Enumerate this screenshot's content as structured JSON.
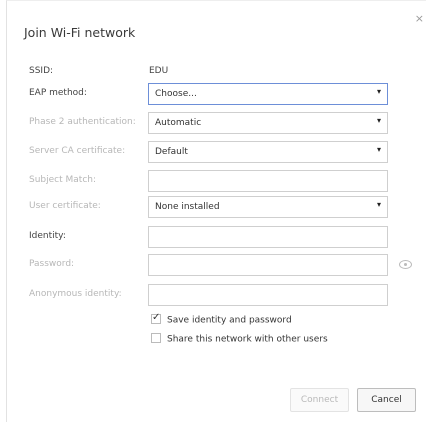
{
  "dialog": {
    "title": "Join Wi-Fi network",
    "close_glyph": "×"
  },
  "form": {
    "ssid": {
      "label": "SSID:",
      "value": "EDU"
    },
    "eap_method": {
      "label": "EAP method:",
      "value": "Choose..."
    },
    "phase2": {
      "label": "Phase 2 authentication:",
      "value": "Automatic"
    },
    "server_ca": {
      "label": "Server CA certificate:",
      "value": "Default"
    },
    "subject_match": {
      "label": "Subject Match:",
      "value": ""
    },
    "user_cert": {
      "label": "User certificate:",
      "value": "None installed"
    },
    "identity": {
      "label": "Identity:",
      "value": ""
    },
    "password": {
      "label": "Password:",
      "value": ""
    },
    "anonymous_identity": {
      "label": "Anonymous identity:",
      "value": ""
    }
  },
  "checkboxes": {
    "save_identity": {
      "label": "Save identity and password",
      "checked": true
    },
    "share_network": {
      "label": "Share this network with other users",
      "checked": false
    }
  },
  "buttons": {
    "connect": "Connect",
    "cancel": "Cancel"
  },
  "icons": {
    "dropdown": "▾",
    "password_reveal": "eye-icon"
  }
}
